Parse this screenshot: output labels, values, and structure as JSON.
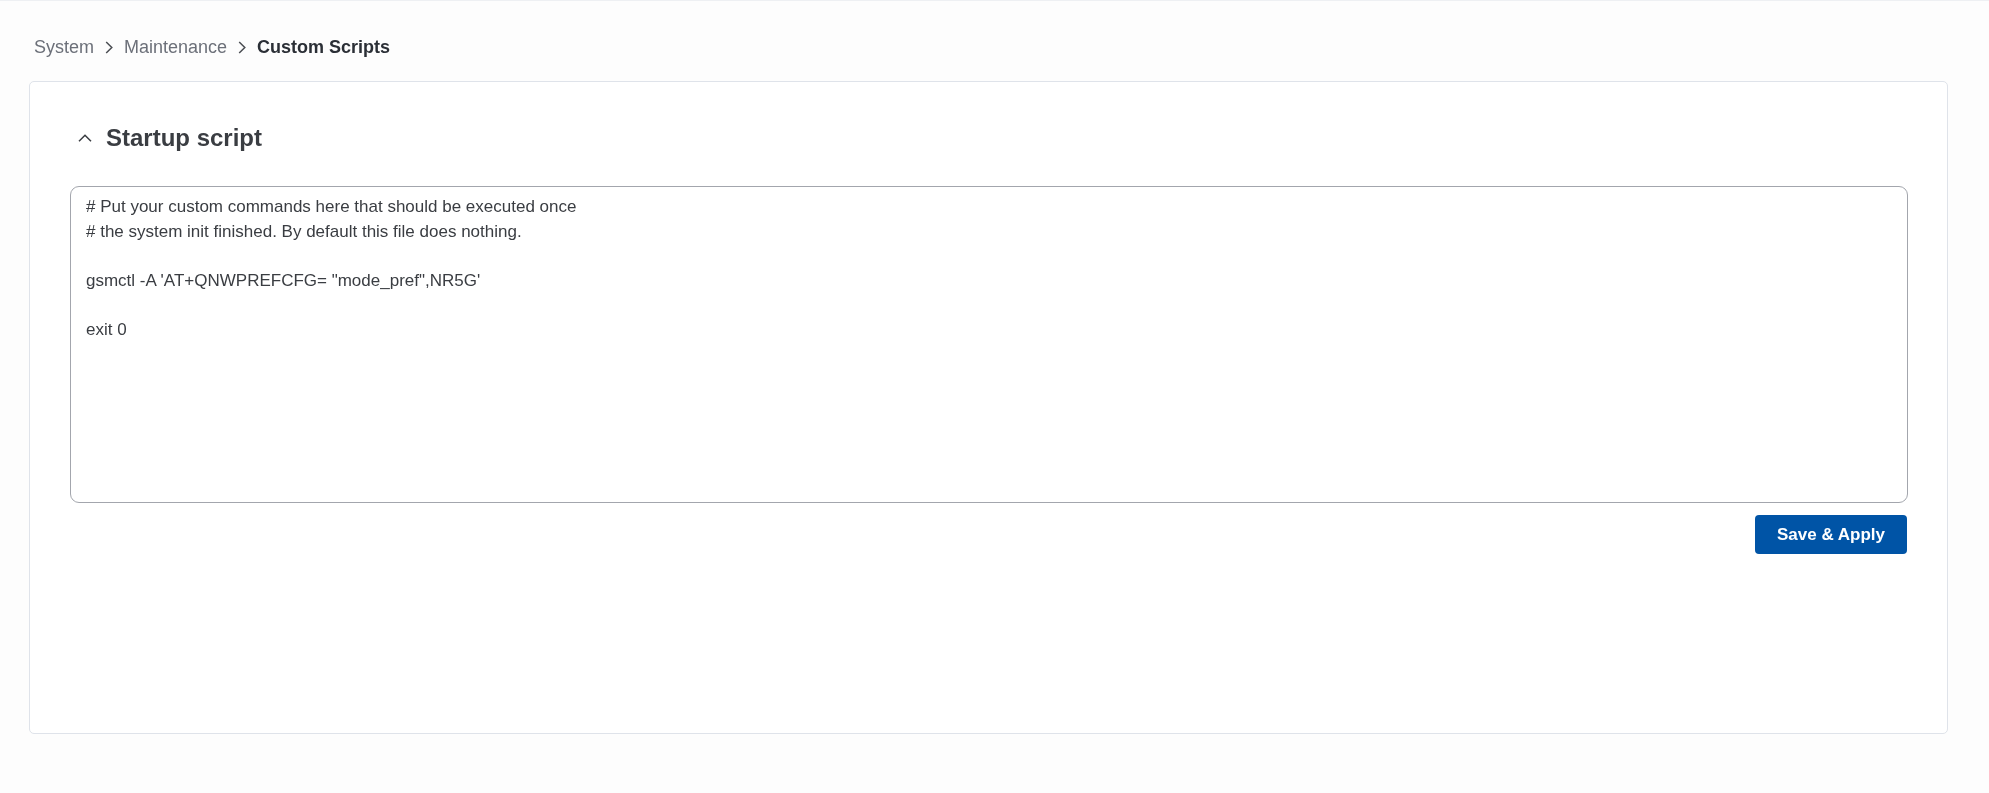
{
  "breadcrumb": [
    {
      "label": "System",
      "current": false
    },
    {
      "label": "Maintenance",
      "current": false
    },
    {
      "label": "Custom Scripts",
      "current": true
    }
  ],
  "section": {
    "title": "Startup script",
    "expanded": true,
    "editor": {
      "value": "# Put your custom commands here that should be executed once\n# the system init finished. By default this file does nothing.\n\ngsmctl -A 'AT+QNWPREFCFG= \"mode_pref\",NR5G'\n\nexit 0"
    },
    "buttons": [
      {
        "label": "Save & Apply"
      }
    ]
  }
}
